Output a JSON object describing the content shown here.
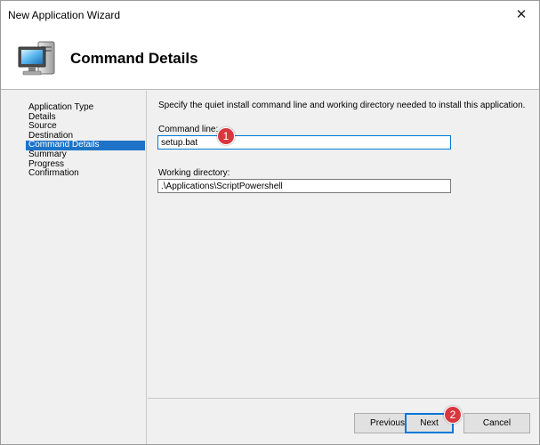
{
  "window": {
    "title": "New Application Wizard"
  },
  "header": {
    "title": "Command Details",
    "icon": "computer-icon"
  },
  "sidebar": {
    "items": [
      {
        "label": "Application Type"
      },
      {
        "label": "Details"
      },
      {
        "label": "Source"
      },
      {
        "label": "Destination"
      },
      {
        "label": "Command Details",
        "active": true
      },
      {
        "label": "Summary"
      },
      {
        "label": "Progress"
      },
      {
        "label": "Confirmation"
      }
    ]
  },
  "content": {
    "instruction": "Specify the quiet install command line and working directory needed to install this application.",
    "command_line": {
      "label": "Command line:",
      "value": "setup.bat"
    },
    "working_directory": {
      "label": "Working directory:",
      "value": ".\\Applications\\ScriptPowershell"
    }
  },
  "buttons": {
    "previous": "Previous",
    "next": "Next",
    "cancel": "Cancel"
  },
  "annotations": {
    "first": "1",
    "second": "2"
  },
  "colors": {
    "accent": "#0078d7",
    "selection": "#1e73c8",
    "badge": "#d9363e"
  }
}
